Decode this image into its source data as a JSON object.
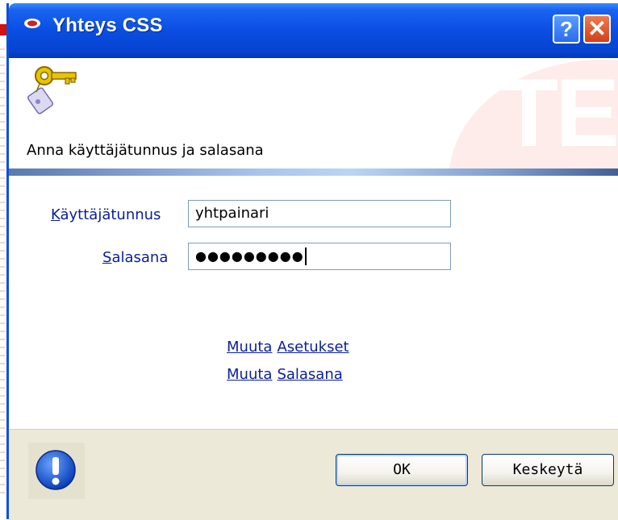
{
  "window": {
    "title": "Yhteys CSS",
    "help_label": "?",
    "close_label": "✕",
    "accent_color": "#0a4ee2"
  },
  "banner": {
    "prompt": "Anna käyttäjätunnus ja salasana",
    "watermark_text": "TE",
    "icon": "key-icon"
  },
  "form": {
    "username_label_access": "K",
    "username_label_rest": "äyttäjätunnus",
    "username_value": "yhtpainari",
    "password_label_access": "S",
    "password_label_rest": "alasana",
    "password_masked": "●●●●●●●●●"
  },
  "links": [
    {
      "prefix": "Muuta",
      "label": "Asetukset"
    },
    {
      "prefix": "Muuta",
      "label": "Salasana"
    }
  ],
  "footer": {
    "info_icon": "exclamation-icon",
    "ok_label": "OK",
    "cancel_label": "Keskeytä"
  }
}
